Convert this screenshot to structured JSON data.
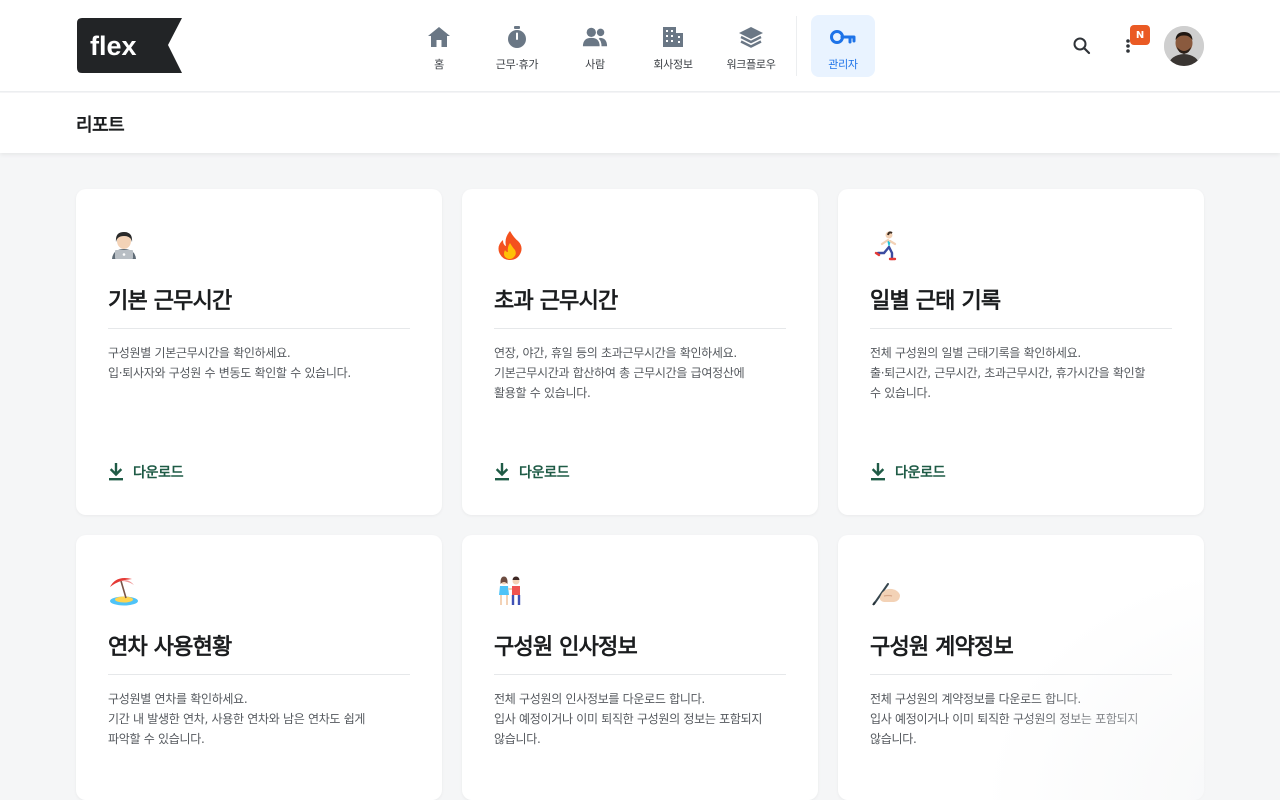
{
  "header": {
    "logo_text": "flex",
    "nav": [
      {
        "label": "홈",
        "icon": "home-icon"
      },
      {
        "label": "근무·휴가",
        "icon": "stopwatch-icon"
      },
      {
        "label": "사람",
        "icon": "people-icon"
      },
      {
        "label": "회사정보",
        "icon": "building-icon"
      },
      {
        "label": "워크플로우",
        "icon": "layers-icon"
      },
      {
        "label": "관리자",
        "icon": "key-icon",
        "active": true
      }
    ],
    "notification_badge": "N",
    "accent_color": "#1e73e8",
    "badge_color": "#ea5a24"
  },
  "page": {
    "title": "리포트"
  },
  "cards": [
    {
      "emoji": "woman-technologist-icon",
      "title": "기본 근무시간",
      "desc": [
        "구성원별 기본근무시간을 확인하세요.",
        "입·퇴사자와 구성원 수 변동도 확인할 수 있습니다."
      ],
      "download_label": "다운로드"
    },
    {
      "emoji": "fire-icon",
      "title": "초과 근무시간",
      "desc": [
        "연장, 야간, 휴일 등의 초과근무시간을 확인하세요.",
        "기본근무시간과 합산하여 총 근무시간을 급여정산에",
        "활용할 수 있습니다."
      ],
      "download_label": "다운로드"
    },
    {
      "emoji": "runner-icon",
      "title": "일별 근태 기록",
      "desc": [
        "전체 구성원의 일별 근태기록을 확인하세요.",
        "출·퇴근시간, 근무시간, 초과근무시간, 휴가시간을 확인할",
        "수 있습니다."
      ],
      "download_label": "다운로드"
    },
    {
      "emoji": "beach-umbrella-icon",
      "title": "연차 사용현황",
      "desc": [
        "구성원별 연차를 확인하세요.",
        "기간 내 발생한 연차, 사용한 연차와 남은 연차도 쉽게",
        "파악할 수 있습니다."
      ],
      "download_label": ""
    },
    {
      "emoji": "couple-icon",
      "title": "구성원 인사정보",
      "desc": [
        "전체 구성원의 인사정보를 다운로드 합니다.",
        "입사 예정이거나 이미 퇴직한 구성원의 정보는 포함되지",
        "않습니다."
      ],
      "download_label": ""
    },
    {
      "emoji": "writing-hand-icon",
      "title": "구성원 계약정보",
      "desc": [
        "전체 구성원의 계약정보를 다운로드 합니다.",
        "입사 예정이거나 이미 퇴직한 구성원의 정보는 포함되지",
        "않습니다."
      ],
      "download_label": ""
    }
  ],
  "download_color": "#1f5b46"
}
